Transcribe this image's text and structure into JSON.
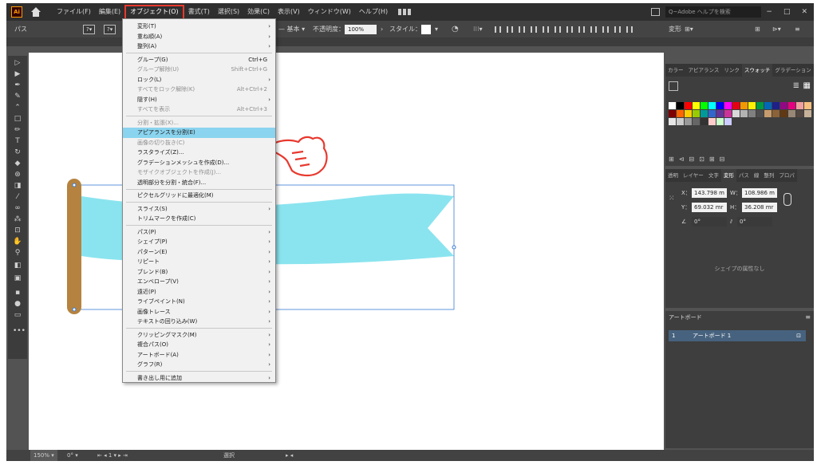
{
  "menubar": {
    "logo": "Ai",
    "items": [
      "ファイル(F)",
      "編集(E)",
      "オブジェクト(O)",
      "書式(T)",
      "選択(S)",
      "効果(C)",
      "表示(V)",
      "ウィンドウ(W)",
      "ヘルプ(H)"
    ],
    "active_index": 2,
    "search_placeholder": "Q~Adobe ヘルプを検索"
  },
  "controlbar": {
    "left_label": "パス",
    "basic": "基本",
    "opacity_label": "不透明度：",
    "opacity_value": "100%",
    "style_label": "スタイル：",
    "transform_label": "変形"
  },
  "object_menu": {
    "groups": [
      [
        {
          "label": "変形(T)",
          "submenu": true
        },
        {
          "label": "重ね順(A)",
          "submenu": true
        },
        {
          "label": "整列(A)",
          "submenu": true
        }
      ],
      [
        {
          "label": "グループ(G)",
          "shortcut": "Ctrl+G"
        },
        {
          "label": "グループ解除(U)",
          "shortcut": "Shift+Ctrl+G",
          "disabled": true
        },
        {
          "label": "ロック(L)",
          "submenu": true
        },
        {
          "label": "すべてをロック解除(K)",
          "shortcut": "Alt+Ctrl+2",
          "disabled": true
        },
        {
          "label": "隠す(H)",
          "submenu": true
        },
        {
          "label": "すべてを表示",
          "shortcut": "Alt+Ctrl+3",
          "disabled": true
        }
      ],
      [
        {
          "label": "分割・拡張(X)...",
          "disabled": true
        },
        {
          "label": "アピアランスを分割(E)",
          "highlight": true
        },
        {
          "label": "画像の切り抜き(C)",
          "disabled": true
        },
        {
          "label": "ラスタライズ(Z)..."
        },
        {
          "label": "グラデーションメッシュを作成(D)..."
        },
        {
          "label": "モザイクオブジェクトを作成(J)...",
          "disabled": true
        },
        {
          "label": "透明部分を分割・統合(F)..."
        }
      ],
      [
        {
          "label": "ピクセルグリッドに最適化(M)"
        }
      ],
      [
        {
          "label": "スライス(S)",
          "submenu": true
        },
        {
          "label": "トリムマークを作成(C)"
        }
      ],
      [
        {
          "label": "パス(P)",
          "submenu": true
        },
        {
          "label": "シェイプ(P)",
          "submenu": true
        },
        {
          "label": "パターン(E)",
          "submenu": true
        },
        {
          "label": "リピート",
          "submenu": true
        },
        {
          "label": "ブレンド(B)",
          "submenu": true
        },
        {
          "label": "エンベロープ(V)",
          "submenu": true
        },
        {
          "label": "遠近(P)",
          "submenu": true
        },
        {
          "label": "ライブペイント(N)",
          "submenu": true
        },
        {
          "label": "画像トレース",
          "submenu": true
        },
        {
          "label": "テキストの回り込み(W)",
          "submenu": true
        }
      ],
      [
        {
          "label": "クリッピングマスク(M)",
          "submenu": true
        },
        {
          "label": "複合パス(O)",
          "submenu": true
        },
        {
          "label": "アートボード(A)",
          "submenu": true
        },
        {
          "label": "グラフ(R)",
          "submenu": true
        }
      ],
      [
        {
          "label": "書き出し用に追加",
          "submenu": true
        }
      ]
    ],
    "submenu_arrow": "›"
  },
  "swatches_panel": {
    "tabs": [
      "カラー",
      "アピアランス",
      "リンク",
      "スウォッチ",
      "グラデーション"
    ],
    "active_tab_index": 3,
    "colors": [
      "#ffffff",
      "#000000",
      "#ff0000",
      "#ffff00",
      "#00ff00",
      "#00ffff",
      "#0000ff",
      "#ff00ff",
      "#e60012",
      "#f39800",
      "#fff100",
      "#009944",
      "#0068b7",
      "#1d2088",
      "#920783",
      "#e4007f",
      "#f0a0a0",
      "#f8c080",
      "#7f0000",
      "#ff6600",
      "#ffcc00",
      "#99cc00",
      "#009999",
      "#3366cc",
      "#663399",
      "#cc3399",
      "#d9d9d9",
      "#b3b3b3",
      "#808080",
      "#4d4d4d",
      "#c69c6d",
      "#8c6239",
      "#603813",
      "#998675",
      "#534741",
      "#c7b299",
      "#e6e6e6",
      "#cccccc",
      "#999999",
      "#666666",
      "#333333",
      "#ffcccc",
      "#ccffcc",
      "#ccccff"
    ]
  },
  "properties_panel": {
    "tabs": [
      "透明",
      "レイヤー",
      "文字",
      "変形",
      "パス",
      "線",
      "整列",
      "プロパ"
    ],
    "active_tab_index": 3,
    "x_label": "X：",
    "x_value": "143.798 m",
    "w_label": "W：",
    "w_value": "108.986 m",
    "y_label": "Y：",
    "y_value": "69.032 mr",
    "h_label": "H：",
    "h_value": "36.208 mr",
    "angle_value": "0°",
    "shear_value": "0°",
    "no_properties": "シェイプの属性なし"
  },
  "artboards_panel": {
    "title": "アートボード",
    "rows": [
      {
        "num": "1",
        "name": "アートボード 1"
      }
    ]
  },
  "statusbar": {
    "zoom": "150%",
    "rotation": "0°",
    "page": "1",
    "mode": "選択"
  },
  "colors": {
    "ribbon": "#8ae4ef",
    "bar": "#b5833f",
    "selection": "#3a7bd5",
    "highlight_row": "#8ad4ef",
    "hand_stroke": "#e8392e"
  }
}
